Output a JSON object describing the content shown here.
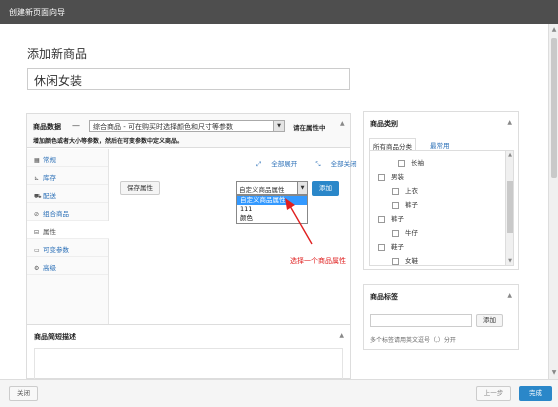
{
  "window": {
    "title": "创建新页面向导"
  },
  "page": {
    "heading": "添加新商品",
    "product_title_value": "休闲女装"
  },
  "product_data": {
    "label": "商品数据",
    "dash": "—",
    "type_selected": "综合商品 - 可在购买时选择颜色和尺寸等参数",
    "help_text": "请在属性中",
    "hint": "增加颜色或者大小等参数，然后在可变参数中定义商品。",
    "tabs": [
      {
        "label": "常规",
        "icon": "grid-icon"
      },
      {
        "label": "库存",
        "icon": "chart-icon"
      },
      {
        "label": "配送",
        "icon": "truck-icon"
      },
      {
        "label": "组合商品",
        "icon": "link-icon"
      },
      {
        "label": "属性",
        "icon": "list-icon"
      },
      {
        "label": "可变参数",
        "icon": "calendar-icon"
      },
      {
        "label": "高级",
        "icon": "gear-icon"
      }
    ],
    "active_tab": "属性",
    "expand_all": "全部展开",
    "collapse_all": "全部关闭",
    "save_attributes": "保存属性",
    "attr_select_value": "自定义商品属性",
    "add_button": "添加",
    "dropdown_options": [
      "自定义商品属性",
      "111",
      "颜色"
    ],
    "dropdown_highlighted": "自定义商品属性"
  },
  "annotation": {
    "text": "选择一个商品属性",
    "color": "#e02020"
  },
  "short_description": {
    "title": "商品简短描述"
  },
  "categories": {
    "title": "商品类别",
    "tab_all": "所有商品分类",
    "tab_common": "最常用",
    "items": [
      {
        "label": "长袖",
        "level": 2
      },
      {
        "label": "男装",
        "level": 1
      },
      {
        "label": "上衣",
        "level": 2
      },
      {
        "label": "裤子",
        "level": 2
      },
      {
        "label": "裤子",
        "level": 1
      },
      {
        "label": "牛仔",
        "level": 2
      },
      {
        "label": "鞋子",
        "level": 1
      },
      {
        "label": "女鞋",
        "level": 2
      }
    ]
  },
  "tags": {
    "title": "商品标签",
    "add_button": "添加",
    "help": "多个标签请用英文逗号（,）分开"
  },
  "footer": {
    "close": "关闭",
    "prev": "上一步",
    "finish": "完成"
  },
  "colors": {
    "accent": "#2a87c9",
    "link": "#2a6fb7",
    "titlebar": "#4e4e4e"
  }
}
